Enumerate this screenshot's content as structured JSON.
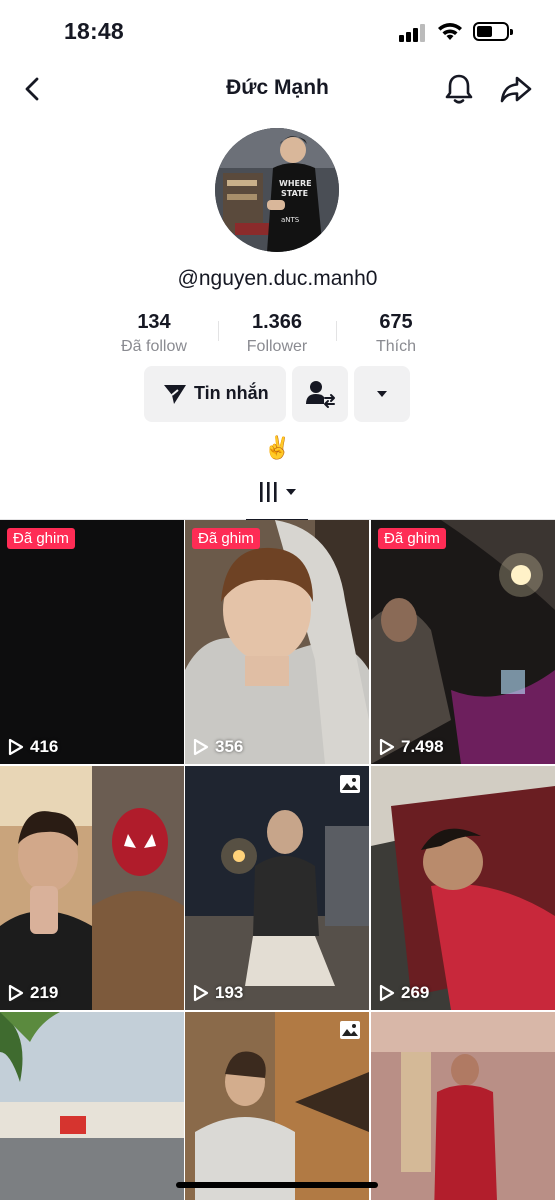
{
  "status_bar": {
    "time": "18:48"
  },
  "header": {
    "title": "Đức Mạnh"
  },
  "profile": {
    "username": "@nguyen.duc.manh0",
    "stats": [
      {
        "value": "134",
        "label": "Đã follow"
      },
      {
        "value": "1.366",
        "label": "Follower"
      },
      {
        "value": "675",
        "label": "Thích"
      }
    ],
    "message_button": "Tin nhắn",
    "bio": "✌️"
  },
  "videos": [
    {
      "pinned_label": "Đã ghim",
      "views": "416"
    },
    {
      "pinned_label": "Đã ghim",
      "views": "356"
    },
    {
      "pinned_label": "Đã ghim",
      "views": "7.498"
    },
    {
      "views": "219"
    },
    {
      "views": "193",
      "photo": true
    },
    {
      "views": "269"
    },
    {
      "views": ""
    },
    {
      "views": "",
      "photo": true
    },
    {
      "views": ""
    }
  ],
  "colors": {
    "pin_badge": "#fe2c55",
    "button_bg": "#f1f1f2",
    "secondary_text": "#8a8b91"
  },
  "icons": {
    "back": "chevron-left-icon",
    "notifications": "bell-icon",
    "share": "share-arrow-icon",
    "message": "send-icon",
    "friend": "user-swap-icon",
    "more": "caret-down-icon",
    "videos_tab": "grid-bars-icon",
    "views": "play-icon",
    "photo": "image-icon"
  }
}
